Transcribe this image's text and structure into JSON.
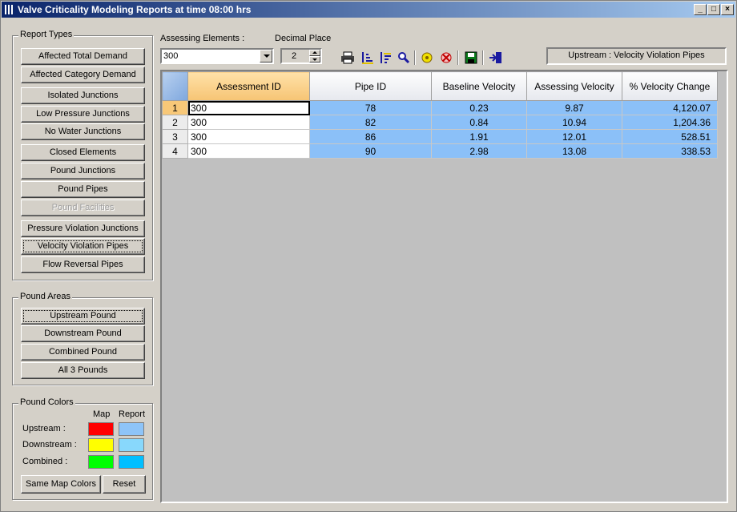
{
  "window": {
    "title": "Valve Criticality Modeling Reports at time 08:00 hrs",
    "minimize": "_",
    "maximize": "□",
    "close": "×"
  },
  "report_types": {
    "legend": "Report Types",
    "buttons": [
      "Affected Total Demand",
      "Affected Category Demand",
      "Isolated Junctions",
      "Low Pressure Junctions",
      "No Water Junctions",
      "Closed Elements",
      "Pound Junctions",
      "Pound Pipes",
      "Pound Facilities",
      "Pressure Violation Junctions",
      "Velocity Violation Pipes",
      "Flow Reversal Pipes"
    ]
  },
  "pound_areas": {
    "legend": "Pound Areas",
    "buttons": [
      "Upstream Pound",
      "Downstream Pound",
      "Combined Pound",
      "All 3 Pounds"
    ]
  },
  "pound_colors": {
    "legend": "Pound Colors",
    "col_map": "Map",
    "col_report": "Report",
    "rows": [
      {
        "label": "Upstream :",
        "map": "#ff0000",
        "report": "#8ec4f8"
      },
      {
        "label": "Downstream :",
        "map": "#ffff00",
        "report": "#88d8fc"
      },
      {
        "label": "Combined :",
        "map": "#00ff00",
        "report": "#00bfff"
      }
    ],
    "same_map_colors": "Same Map Colors",
    "reset": "Reset"
  },
  "controls": {
    "assessing_label": "Assessing Elements :",
    "assessing_value": "300",
    "decimal_label": "Decimal Place",
    "decimal_value": "2",
    "status": "Upstream : Velocity Violation Pipes"
  },
  "toolbar": [
    "print-icon",
    "sort-ascending-icon",
    "sort-descending-icon",
    "find-icon",
    "highlight-icon",
    "clear-highlight-icon",
    "save-icon",
    "exit-icon"
  ],
  "grid": {
    "columns": [
      "Assessment ID",
      "Pipe ID",
      "Baseline Velocity",
      "Assessing Velocity",
      "% Velocity Change"
    ],
    "rows": [
      {
        "n": "1",
        "assessment_id": "300",
        "pipe_id": "78",
        "baseline": "0.23",
        "assessing": "9.87",
        "change": "4,120.07"
      },
      {
        "n": "2",
        "assessment_id": "300",
        "pipe_id": "82",
        "baseline": "0.84",
        "assessing": "10.94",
        "change": "1,204.36"
      },
      {
        "n": "3",
        "assessment_id": "300",
        "pipe_id": "86",
        "baseline": "1.91",
        "assessing": "12.01",
        "change": "528.51"
      },
      {
        "n": "4",
        "assessment_id": "300",
        "pipe_id": "90",
        "baseline": "2.98",
        "assessing": "13.08",
        "change": "338.53"
      }
    ]
  }
}
